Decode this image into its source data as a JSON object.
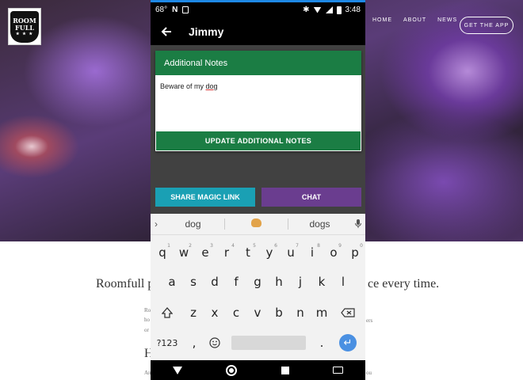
{
  "website": {
    "logo": {
      "line1": "ROOM",
      "line2": "FULL",
      "stars": "★ ★ ★"
    },
    "nav": {
      "home": "HOME",
      "about": "ABOUT",
      "news": "NEWS",
      "get_app": "GET THE APP"
    },
    "tagline_left": "Roomfull pu",
    "tagline_right": "ce every time.",
    "small_left": [
      "Ro",
      "ho",
      "or"
    ],
    "small_right": "ers",
    "heading_partial": "H",
    "bottom_small_left": "An",
    "bottom_small_right": "ou"
  },
  "phone": {
    "status": {
      "temp": "68°",
      "carrier": "N",
      "time": "3:48"
    },
    "app_bar": {
      "title": "Jimmy"
    },
    "notes_card": {
      "header": "Additional Notes",
      "text_before": "Beware of my ",
      "text_underlined": "dog",
      "update_button": "UPDATE ADDITIONAL NOTES"
    },
    "actions": {
      "share_magic_link": "SHARE MAGIC LINK",
      "chat": "CHAT"
    },
    "keyboard": {
      "suggestions": [
        "dog",
        "dogs"
      ],
      "row1": [
        "q",
        "w",
        "e",
        "r",
        "t",
        "y",
        "u",
        "i",
        "o",
        "p"
      ],
      "row1_sup": [
        "1",
        "2",
        "3",
        "4",
        "5",
        "6",
        "7",
        "8",
        "9",
        "0"
      ],
      "row2": [
        "a",
        "s",
        "d",
        "f",
        "g",
        "h",
        "j",
        "k",
        "l"
      ],
      "row3": [
        "z",
        "x",
        "c",
        "v",
        "b",
        "n",
        "m"
      ],
      "symbols_key": "?123",
      "comma": ",",
      "period": "."
    }
  },
  "colors": {
    "green": "#1b7d44",
    "teal": "#1aa0b4",
    "purple": "#6a3d8f",
    "enter_blue": "#4a90e2"
  }
}
